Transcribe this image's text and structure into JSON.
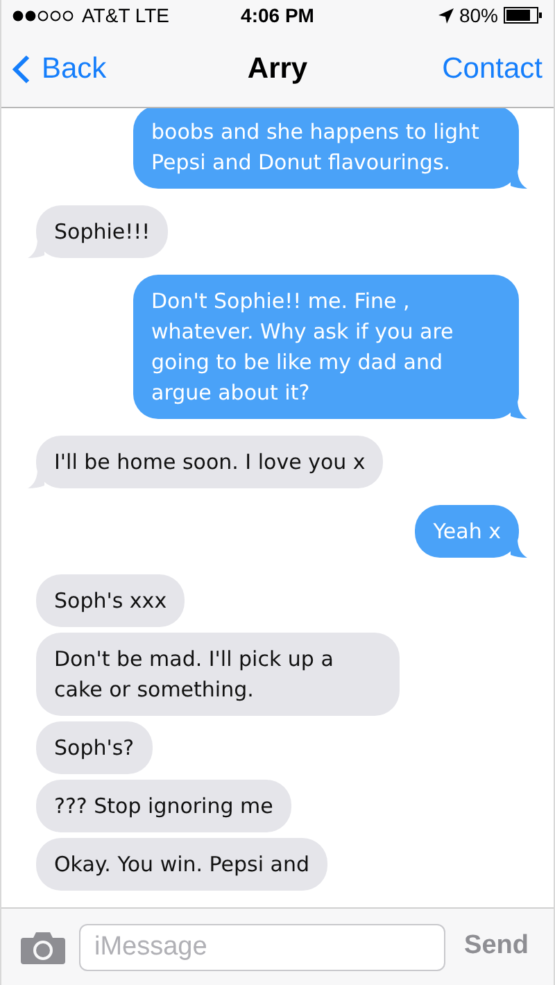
{
  "status_bar": {
    "carrier": "AT&T LTE",
    "time": "4:06 PM",
    "battery": "80%"
  },
  "nav": {
    "back": "Back",
    "title": "Arry",
    "action": "Contact"
  },
  "messages": [
    {
      "kind": "sent",
      "text": "boobs and she happens to light Pepsi and Donut flavourings.",
      "tail": true
    },
    {
      "kind": "received",
      "text": "Sophie!!!",
      "tail": true
    },
    {
      "kind": "sent",
      "text": "Don't Sophie!! me. Fine , whatever. Why ask if you are going to be like my dad and argue about it?",
      "tail": true
    },
    {
      "kind": "received",
      "text": "I'll be home soon. I love you x",
      "tail": true
    },
    {
      "kind": "sent",
      "text": "Yeah x",
      "tail": true
    },
    {
      "kind": "received",
      "text": "Soph's xxx",
      "tail": false
    },
    {
      "kind": "received",
      "text": "Don't be mad. I'll pick up a cake or something.",
      "tail": false
    },
    {
      "kind": "received",
      "text": "Soph's?",
      "tail": false
    },
    {
      "kind": "received",
      "text": "??? Stop ignoring me",
      "tail": false
    },
    {
      "kind": "received",
      "text": "Okay. You win. Pepsi and",
      "tail": false
    }
  ],
  "composer": {
    "placeholder": "iMessage",
    "send": "Send"
  }
}
